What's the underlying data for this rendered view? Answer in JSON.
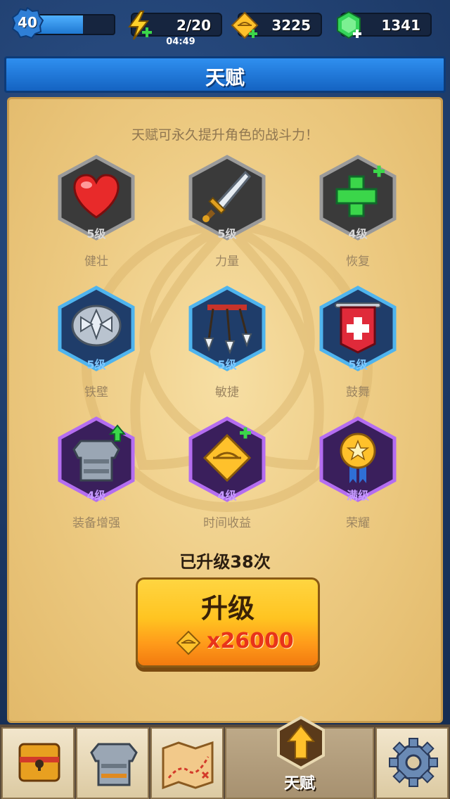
{
  "topbar": {
    "level": "40",
    "xp_fraction": 0.62,
    "energy": "2/20",
    "energy_timer": "04:49",
    "coins": "3225",
    "gems": "1341"
  },
  "header": {
    "title": "天赋"
  },
  "panel": {
    "subtitle": "天赋可永久提升角色的战斗力！",
    "talents": [
      {
        "level": "5级",
        "name": "健壮",
        "icon": "heart-icon",
        "tier": "gray"
      },
      {
        "level": "5级",
        "name": "力量",
        "icon": "sword-icon",
        "tier": "gray"
      },
      {
        "level": "4级",
        "name": "恢复",
        "icon": "green-cross-icon",
        "tier": "gray"
      },
      {
        "level": "5级",
        "name": "铁壁",
        "icon": "spiked-shield-icon",
        "tier": "blue"
      },
      {
        "level": "5级",
        "name": "敏捷",
        "icon": "arrows-icon",
        "tier": "blue"
      },
      {
        "level": "5级",
        "name": "鼓舞",
        "icon": "banner-icon",
        "tier": "blue"
      },
      {
        "level": "4级",
        "name": "装备增强",
        "icon": "armor-icon",
        "tier": "purple"
      },
      {
        "level": "4级",
        "name": "时间收益",
        "icon": "coin-plus-icon",
        "tier": "purple"
      },
      {
        "level": "满级",
        "name": "荣耀",
        "icon": "medal-icon",
        "tier": "purple"
      }
    ],
    "upgrade_count": "已升级38次",
    "upgrade_label": "升级",
    "upgrade_cost": "x26000"
  },
  "nav": {
    "items": [
      {
        "name": "chest",
        "icon": "chest-icon"
      },
      {
        "name": "armor",
        "icon": "armor-icon"
      },
      {
        "name": "map",
        "icon": "map-icon"
      },
      {
        "name": "talent",
        "icon": "arrow-up-icon",
        "label": "天赋",
        "active": true
      },
      {
        "name": "settings",
        "icon": "gear-icon"
      }
    ]
  },
  "colors": {
    "gray_tier": "#3c3c3c",
    "blue_tier": "#1f3d6a",
    "purple_tier": "#3a1f5c",
    "accent": "#ffc421"
  }
}
